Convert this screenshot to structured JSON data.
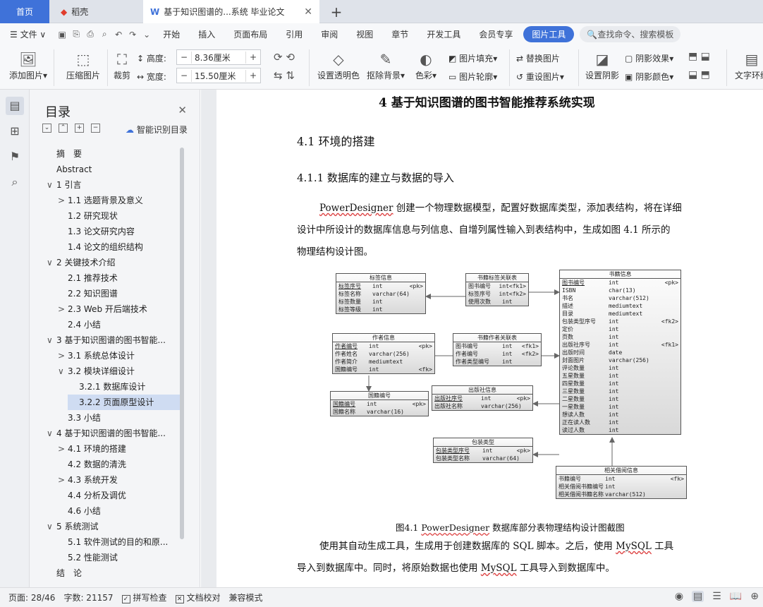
{
  "tabs": {
    "home": "首页",
    "daoke": "稻壳",
    "doc": "基于知识图谱的...系统 毕业论文"
  },
  "menu": {
    "file": "文件",
    "items": [
      "开始",
      "插入",
      "页面布局",
      "引用",
      "审阅",
      "视图",
      "章节",
      "开发工具",
      "会员专享"
    ],
    "active": "图片工具",
    "search": "查找命令、搜索模板"
  },
  "ribbon": {
    "add_image": "添加图片",
    "compress": "压缩图片",
    "crop": "裁剪",
    "height_label": "高度:",
    "height_value": "8.36厘米",
    "width_label": "宽度:",
    "width_value": "15.50厘米",
    "transparency": "设置透明色",
    "remove_bg": "抠除背景",
    "color": "色彩",
    "fill": "图片填充",
    "outline": "图片轮廓",
    "replace": "替换图片",
    "reset": "重设图片",
    "shadow_set": "设置阴影",
    "shadow_effect": "阴影效果",
    "shadow_color": "阴影颜色",
    "text_wrap": "文字环绕"
  },
  "toc": {
    "title": "目录",
    "smart": "智能识别目录",
    "items": [
      {
        "label": "摘　要",
        "level": 0,
        "arrow": ""
      },
      {
        "label": "Abstract",
        "level": 0,
        "arrow": ""
      },
      {
        "label": "1 引言",
        "level": 0,
        "arrow": "∨"
      },
      {
        "label": "1.1 选题背景及意义",
        "level": 1,
        "arrow": ">"
      },
      {
        "label": "1.2 研究现状",
        "level": 1,
        "arrow": ""
      },
      {
        "label": "1.3 论文研究内容",
        "level": 1,
        "arrow": ""
      },
      {
        "label": "1.4 论文的组织结构",
        "level": 1,
        "arrow": ""
      },
      {
        "label": "2 关键技术介绍",
        "level": 0,
        "arrow": "∨"
      },
      {
        "label": "2.1 推荐技术",
        "level": 1,
        "arrow": ""
      },
      {
        "label": "2.2 知识图谱",
        "level": 1,
        "arrow": ""
      },
      {
        "label": "2.3 Web 开后端技术",
        "level": 1,
        "arrow": ">"
      },
      {
        "label": "2.4 小结",
        "level": 1,
        "arrow": ""
      },
      {
        "label": "3 基于知识图谱的图书智能...",
        "level": 0,
        "arrow": "∨"
      },
      {
        "label": "3.1 系统总体设计",
        "level": 1,
        "arrow": ">"
      },
      {
        "label": "3.2 模块详细设计",
        "level": 1,
        "arrow": "∨"
      },
      {
        "label": "3.2.1 数据库设计",
        "level": 2,
        "arrow": ""
      },
      {
        "label": "3.2.2 页面原型设计",
        "level": 2,
        "arrow": ""
      },
      {
        "label": "3.3 小结",
        "level": 1,
        "arrow": ""
      },
      {
        "label": "4 基于知识图谱的图书智能...",
        "level": 0,
        "arrow": "∨"
      },
      {
        "label": "4.1 环境的搭建",
        "level": 1,
        "arrow": ">"
      },
      {
        "label": "4.2 数据的清洗",
        "level": 1,
        "arrow": ""
      },
      {
        "label": "4.3 系统开发",
        "level": 1,
        "arrow": ">"
      },
      {
        "label": "4.4 分析及调优",
        "level": 1,
        "arrow": ""
      },
      {
        "label": "4.6 小结",
        "level": 1,
        "arrow": ""
      },
      {
        "label": "5 系统测试",
        "level": 0,
        "arrow": "∨"
      },
      {
        "label": "5.1 软件测试的目的和原...",
        "level": 1,
        "arrow": ""
      },
      {
        "label": "5.2 性能测试",
        "level": 1,
        "arrow": ""
      },
      {
        "label": "结　论",
        "level": 0,
        "arrow": ""
      }
    ]
  },
  "doc": {
    "h1": "4  基于知识图谱的图书智能推荐系统实现",
    "h2": "4.1  环境的搭建",
    "h3": "4.1.1  数据库的建立与数据的导入",
    "p1_l1a": "PowerDesigner",
    "p1_l1b": " 创建一个物理数据模型，配置好数据库类型，添加表结构，将在详细",
    "p1_l2": "设计中所设计的数据库信息与列信息、自增列属性输入到表结构中，生成如图 4.1 所示的",
    "p1_l3": "物理结构设计图。",
    "caption_a": "图4.1 ",
    "caption_b": "PowerDesigner",
    "caption_c": " 数据库部分表物理结构设计图截图",
    "p2_l1a": "使用其自动生成工具，生成用于创建数据库的 SQL 脚本。之后，使用 ",
    "p2_l1b": "MySQL",
    "p2_l1c": " 工具",
    "p2_l2a": "导入到数据库中。同时，将原始数据也使用 ",
    "p2_l2b": "MySQL",
    "p2_l2c": " 工具导入到数据库中。"
  },
  "erd": {
    "tag": {
      "title": "标签信息",
      "rows": [
        [
          "标签序号",
          "int",
          "<pk>"
        ],
        [
          "标签名称",
          "varchar(64)",
          ""
        ],
        [
          "标签数量",
          "int",
          ""
        ],
        [
          "标签等级",
          "int",
          ""
        ]
      ]
    },
    "booktag": {
      "title": "书籍标签关联表",
      "rows": [
        [
          "图书编号",
          "int",
          "<fk1>"
        ],
        [
          "标签序号",
          "int",
          "<fk2>"
        ],
        [
          "使用次数",
          "int",
          ""
        ]
      ]
    },
    "book": {
      "title": "书籍信息",
      "rows": [
        [
          "图书编号",
          "int",
          "<pk>"
        ],
        [
          "ISBN",
          "char(13)",
          ""
        ],
        [
          "书名",
          "varchar(512)",
          ""
        ],
        [
          "描述",
          "mediumtext",
          ""
        ],
        [
          "目录",
          "mediumtext",
          ""
        ],
        [
          "包装类型序号",
          "int",
          "<fk2>"
        ],
        [
          "定价",
          "int",
          ""
        ],
        [
          "页数",
          "int",
          ""
        ],
        [
          "出版社序号",
          "int",
          "<fk1>"
        ],
        [
          "出版时间",
          "date",
          ""
        ],
        [
          "封面图片",
          "varchar(256)",
          ""
        ],
        [
          "评论数量",
          "int",
          ""
        ],
        [
          "五星数量",
          "int",
          ""
        ],
        [
          "四星数量",
          "int",
          ""
        ],
        [
          "三星数量",
          "int",
          ""
        ],
        [
          "二星数量",
          "int",
          ""
        ],
        [
          "一星数量",
          "int",
          ""
        ],
        [
          "想读人数",
          "int",
          ""
        ],
        [
          "正在读人数",
          "int",
          ""
        ],
        [
          "读过人数",
          "int",
          ""
        ]
      ]
    },
    "author": {
      "title": "作者信息",
      "rows": [
        [
          "作者编号",
          "int",
          "<pk>"
        ],
        [
          "作者姓名",
          "varchar(256)",
          ""
        ],
        [
          "作者简介",
          "mediumtext",
          ""
        ],
        [
          "国籍编号",
          "int",
          "<fk>"
        ]
      ]
    },
    "bookauthor": {
      "title": "书籍作者关联表",
      "rows": [
        [
          "图书编号",
          "int",
          "<fk1>"
        ],
        [
          "作者编号",
          "int",
          "<fk2>"
        ],
        [
          "作者类型编号",
          "int",
          ""
        ]
      ]
    },
    "nation": {
      "title": "国籍编号",
      "rows": [
        [
          "国籍编号",
          "int",
          "<pk>"
        ],
        [
          "国籍名称",
          "varchar(16)",
          ""
        ]
      ]
    },
    "publisher": {
      "title": "出版社信息",
      "rows": [
        [
          "出版社序号",
          "int",
          "<pk>"
        ],
        [
          "出版社名称",
          "varchar(256)",
          ""
        ]
      ]
    },
    "pack": {
      "title": "包装类型",
      "rows": [
        [
          "包装类型序号",
          "int",
          "<pk>"
        ],
        [
          "包装类型名称",
          "varchar(64)",
          ""
        ]
      ]
    },
    "related": {
      "title": "相关借阅信息",
      "rows": [
        [
          "书籍编号",
          "int",
          "<fk>"
        ],
        [
          "相关借阅书籍编号",
          "int",
          ""
        ],
        [
          "相关借阅书籍名称",
          "varchar(512)",
          ""
        ]
      ]
    }
  },
  "status": {
    "page": "页面: 28/46",
    "words": "字数: 21157",
    "spell": "拼写检查",
    "proof": "文档校对",
    "compat": "兼容模式"
  }
}
